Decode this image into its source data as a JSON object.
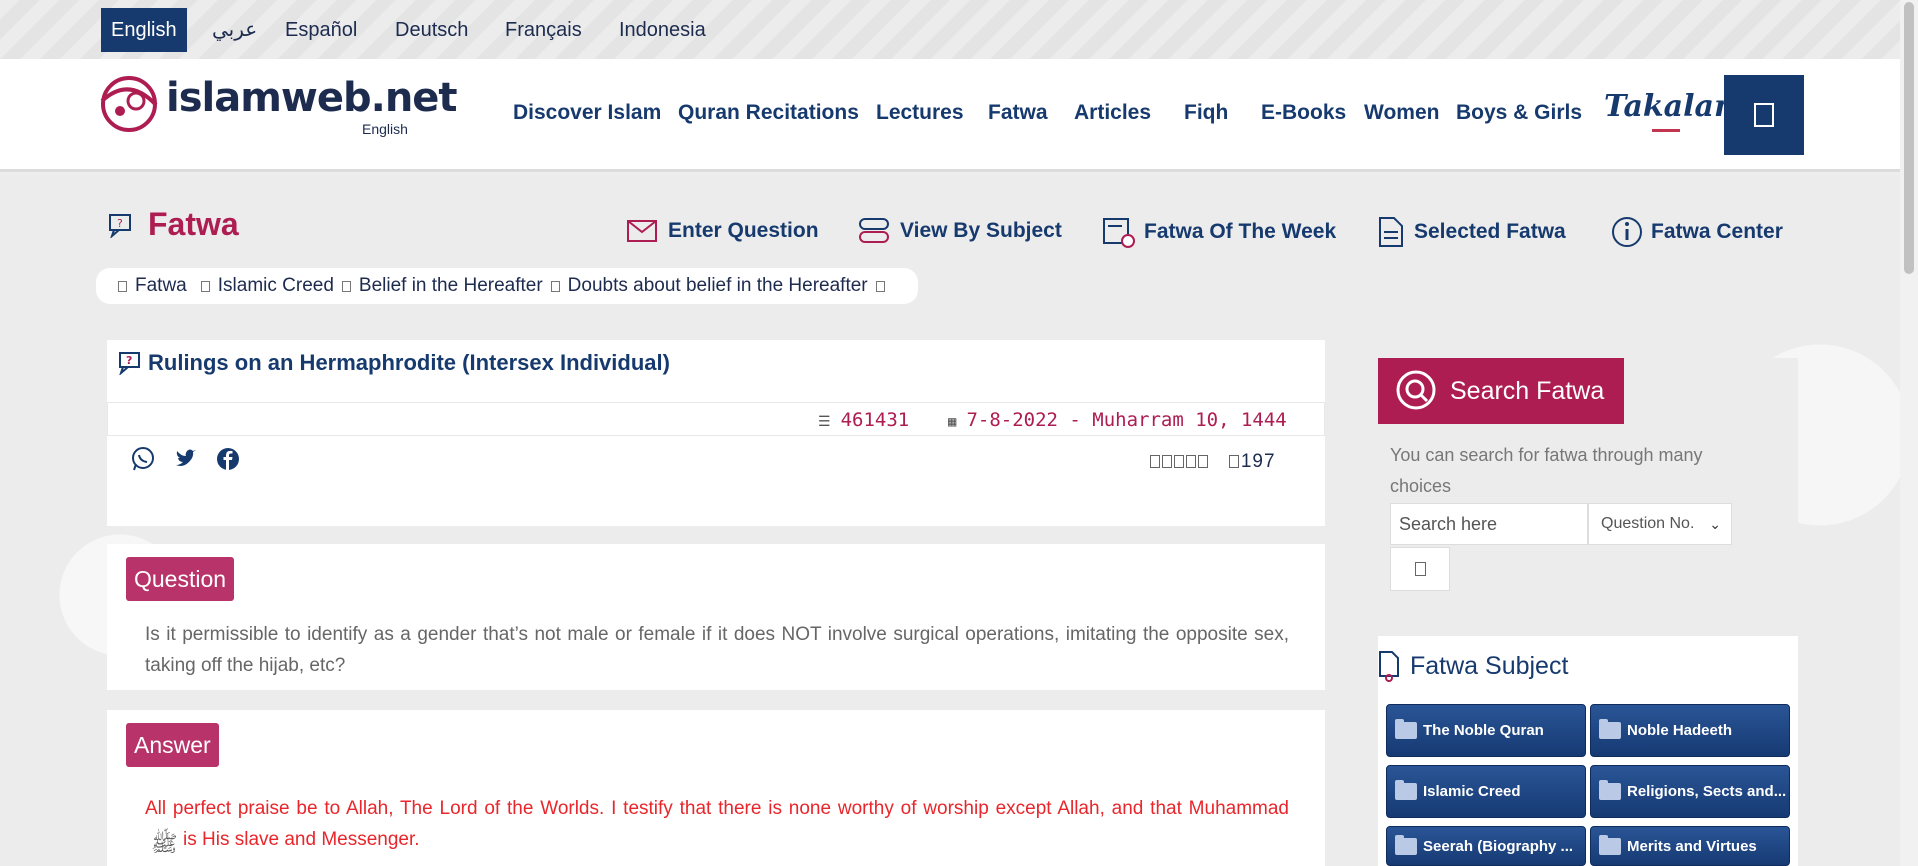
{
  "languages": [
    {
      "label": "English",
      "active": true
    },
    {
      "label": "عربي"
    },
    {
      "label": "Español"
    },
    {
      "label": "Deutsch"
    },
    {
      "label": "Français"
    },
    {
      "label": "Indonesia"
    }
  ],
  "logo": {
    "text": "islamweb.net",
    "sub": "English"
  },
  "nav": [
    "Discover Islam",
    "Quran Recitations",
    "Lectures",
    "Fatwa",
    "Articles",
    "Fiqh",
    "E-Books",
    "Women",
    "Boys & Girls"
  ],
  "takalam": "Takalam",
  "fatwa_header": {
    "title": "Fatwa",
    "links": [
      "Enter Question",
      "View By Subject",
      "Fatwa Of The Week",
      "Selected Fatwa",
      "Fatwa Center"
    ]
  },
  "breadcrumb": [
    "Fatwa",
    "Islamic Creed",
    "Belief in the Hereafter",
    "Doubts about belief in the Hereafter"
  ],
  "article": {
    "title": "Rulings on an Hermaphrodite (Intersex Individual)",
    "number": "461431",
    "date": "7-8-2022 - Muharram 10, 1444",
    "views": "197",
    "question_label": "Question",
    "question_text": "Is it permissible to identify as a gender that’s not male or female if it does NOT involve surgical operations, imitating the opposite sex, taking off the hijab, etc?",
    "answer_label": "Answer",
    "answer_text_1": "All perfect praise be to Allah, The Lord of the Worlds. I testify that there is none worthy of worship except Allah, and that Muhammad",
    "answer_text_2": "is His slave and Messenger."
  },
  "share_icons": [
    "whatsapp-icon",
    "twitter-icon",
    "facebook-icon"
  ],
  "search": {
    "title": "Search Fatwa",
    "description": "You can search for fatwa through many choices",
    "placeholder": "Search here",
    "select_value": "Question No."
  },
  "subjects": {
    "title": "Fatwa Subject",
    "items": [
      "The Noble Quran",
      "Noble Hadeeth",
      "Islamic Creed",
      "Religions, Sects and...",
      "Seerah (Biography ...",
      "Merits and Virtues"
    ]
  },
  "colors": {
    "primary": "#173a6e",
    "accent": "#ad1d51",
    "tag": "#b8336a",
    "answer_red": "#e8262b"
  }
}
